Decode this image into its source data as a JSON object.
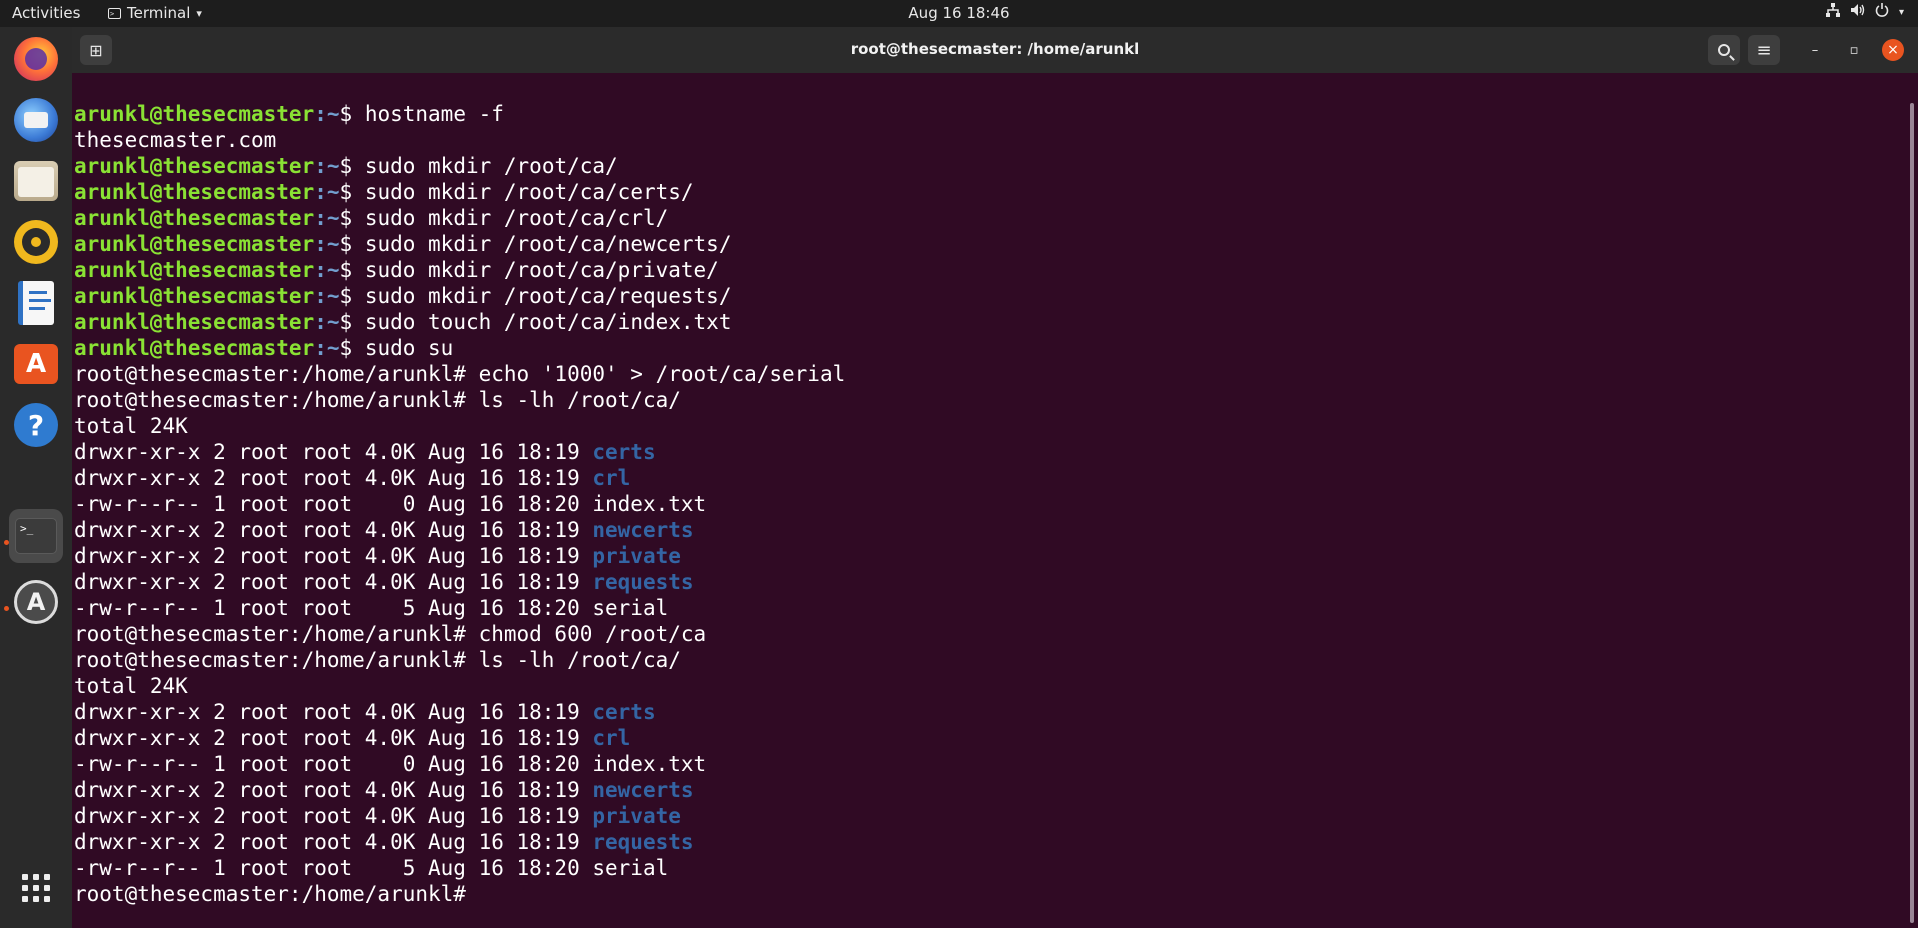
{
  "topbar": {
    "activities": "Activities",
    "app_name": "Terminal",
    "app_caret": "▾",
    "clock": "Aug 16  18:46",
    "tray": {
      "network": "network-icon",
      "volume": "volume-icon",
      "power": "power-icon",
      "menu": "chevron-down-icon"
    }
  },
  "dock": {
    "items": [
      {
        "name": "firefox-icon",
        "color": "#ff7139"
      },
      {
        "name": "thunderbird-icon",
        "color": "#3c7bd6"
      },
      {
        "name": "files-icon",
        "color": "#c8b89a"
      },
      {
        "name": "rhythmbox-icon",
        "color": "#f0b81e"
      },
      {
        "name": "libreoffice-writer-icon",
        "color": "#2f72c4"
      },
      {
        "name": "software-icon",
        "color": "#e95420"
      },
      {
        "name": "help-icon",
        "color": "#2f7bd0"
      },
      {
        "name": "terminal-icon",
        "color": "#3b3b3b"
      },
      {
        "name": "updater-icon",
        "color": "#4b4b4b"
      }
    ],
    "help_glyph": "?",
    "software_glyph": "A",
    "terminal_glyph": ">_",
    "show_apps": "show-apps-grid-icon"
  },
  "window": {
    "title": "root@thesecmaster: /home/arunkl",
    "new_tab": "new-tab-icon",
    "search": "search-icon",
    "menu": "hamburger-menu-icon",
    "minimize": "minimize-icon",
    "maximize": "maximize-icon",
    "close": "close-icon",
    "minimize_glyph": "–",
    "maximize_glyph": "▫",
    "close_glyph": "×",
    "menu_glyph": "≡",
    "new_tab_glyph": "⊞"
  },
  "terminal": {
    "user_host": "arunkl@thesecmaster",
    "user_path": ":~",
    "user_dollar": "$ ",
    "root_prompt": "root@thesecmaster:/home/arunkl# ",
    "lines": [
      {
        "type": "user",
        "cmd": "hostname -f"
      },
      {
        "type": "out",
        "text": "thesecmaster.com"
      },
      {
        "type": "user",
        "cmd": "sudo mkdir /root/ca/"
      },
      {
        "type": "user",
        "cmd": "sudo mkdir /root/ca/certs/"
      },
      {
        "type": "user",
        "cmd": "sudo mkdir /root/ca/crl/"
      },
      {
        "type": "user",
        "cmd": "sudo mkdir /root/ca/newcerts/"
      },
      {
        "type": "user",
        "cmd": "sudo mkdir /root/ca/private/"
      },
      {
        "type": "user",
        "cmd": "sudo mkdir /root/ca/requests/"
      },
      {
        "type": "user",
        "cmd": "sudo touch /root/ca/index.txt"
      },
      {
        "type": "user",
        "cmd": "sudo su"
      },
      {
        "type": "root",
        "cmd": "echo '1000' > /root/ca/serial"
      },
      {
        "type": "root",
        "cmd": "ls -lh /root/ca/"
      },
      {
        "type": "out",
        "text": "total 24K"
      },
      {
        "type": "ls",
        "meta": "drwxr-xr-x 2 root root 4.0K Aug 16 18:19 ",
        "file": "certs",
        "dir": true
      },
      {
        "type": "ls",
        "meta": "drwxr-xr-x 2 root root 4.0K Aug 16 18:19 ",
        "file": "crl",
        "dir": true
      },
      {
        "type": "ls",
        "meta": "-rw-r--r-- 1 root root    0 Aug 16 18:20 ",
        "file": "index.txt",
        "dir": false
      },
      {
        "type": "ls",
        "meta": "drwxr-xr-x 2 root root 4.0K Aug 16 18:19 ",
        "file": "newcerts",
        "dir": true
      },
      {
        "type": "ls",
        "meta": "drwxr-xr-x 2 root root 4.0K Aug 16 18:19 ",
        "file": "private",
        "dir": true
      },
      {
        "type": "ls",
        "meta": "drwxr-xr-x 2 root root 4.0K Aug 16 18:19 ",
        "file": "requests",
        "dir": true
      },
      {
        "type": "ls",
        "meta": "-rw-r--r-- 1 root root    5 Aug 16 18:20 ",
        "file": "serial",
        "dir": false
      },
      {
        "type": "root",
        "cmd": "chmod 600 /root/ca"
      },
      {
        "type": "root",
        "cmd": "ls -lh /root/ca/"
      },
      {
        "type": "out",
        "text": "total 24K"
      },
      {
        "type": "ls",
        "meta": "drwxr-xr-x 2 root root 4.0K Aug 16 18:19 ",
        "file": "certs",
        "dir": true
      },
      {
        "type": "ls",
        "meta": "drwxr-xr-x 2 root root 4.0K Aug 16 18:19 ",
        "file": "crl",
        "dir": true
      },
      {
        "type": "ls",
        "meta": "-rw-r--r-- 1 root root    0 Aug 16 18:20 ",
        "file": "index.txt",
        "dir": false
      },
      {
        "type": "ls",
        "meta": "drwxr-xr-x 2 root root 4.0K Aug 16 18:19 ",
        "file": "newcerts",
        "dir": true
      },
      {
        "type": "ls",
        "meta": "drwxr-xr-x 2 root root 4.0K Aug 16 18:19 ",
        "file": "private",
        "dir": true
      },
      {
        "type": "ls",
        "meta": "drwxr-xr-x 2 root root 4.0K Aug 16 18:19 ",
        "file": "requests",
        "dir": true
      },
      {
        "type": "ls",
        "meta": "-rw-r--r-- 1 root root    5 Aug 16 18:20 ",
        "file": "serial",
        "dir": false
      },
      {
        "type": "root",
        "cmd": ""
      }
    ],
    "colors": {
      "background": "#300a24",
      "prompt_user": "#8ae234",
      "prompt_path": "#729fcf",
      "directory": "#3465a4",
      "text": "#ffffff"
    }
  }
}
